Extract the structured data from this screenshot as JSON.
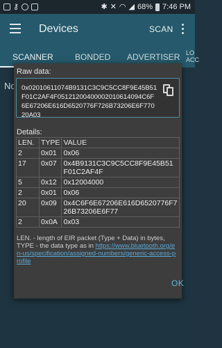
{
  "status_bar": {
    "battery_text": "68%",
    "time": "7:46 PM"
  },
  "app_bar": {
    "title": "Devices",
    "scan_label": "SCAN"
  },
  "tabs": [
    {
      "label": "SCANNER",
      "active": true
    },
    {
      "label": "BONDED"
    },
    {
      "label": "ADVERTISER"
    },
    {
      "label": "LO\nACC"
    }
  ],
  "background": {
    "no_text": "No"
  },
  "dialog": {
    "raw_label": "Raw data:",
    "raw_data": "0x02010611074B9131C3C9C5CC8F9E45B51F01C2AF4F05121200400002010614094C6F6E67206E616D6520776F726B73206E6F77020A03",
    "details_label": "Details:",
    "table": {
      "headers": [
        "LEN.",
        "TYPE",
        "VALUE"
      ],
      "rows": [
        [
          "2",
          "0x01",
          "0x06"
        ],
        [
          "17",
          "0x07",
          "0x4B9131C3C9C5CC8F9E45B51F01C2AF4F"
        ],
        [
          "5",
          "0x12",
          "0x12004000"
        ],
        [
          "2",
          "0x01",
          "0x06"
        ],
        [
          "20",
          "0x09",
          "0x4C6F6E67206E616D6520776F726B73206E6F77"
        ],
        [
          "2",
          "0x0A",
          "0x03"
        ]
      ]
    },
    "legend_text": "LEN. - length of EIR packet (Type + Data) in bytes, TYPE - the data type as in ",
    "legend_link": "https://www.bluetooth.org/en-us/specification/assigned-numbers/generic-access-profile",
    "ok_label": "OK"
  }
}
